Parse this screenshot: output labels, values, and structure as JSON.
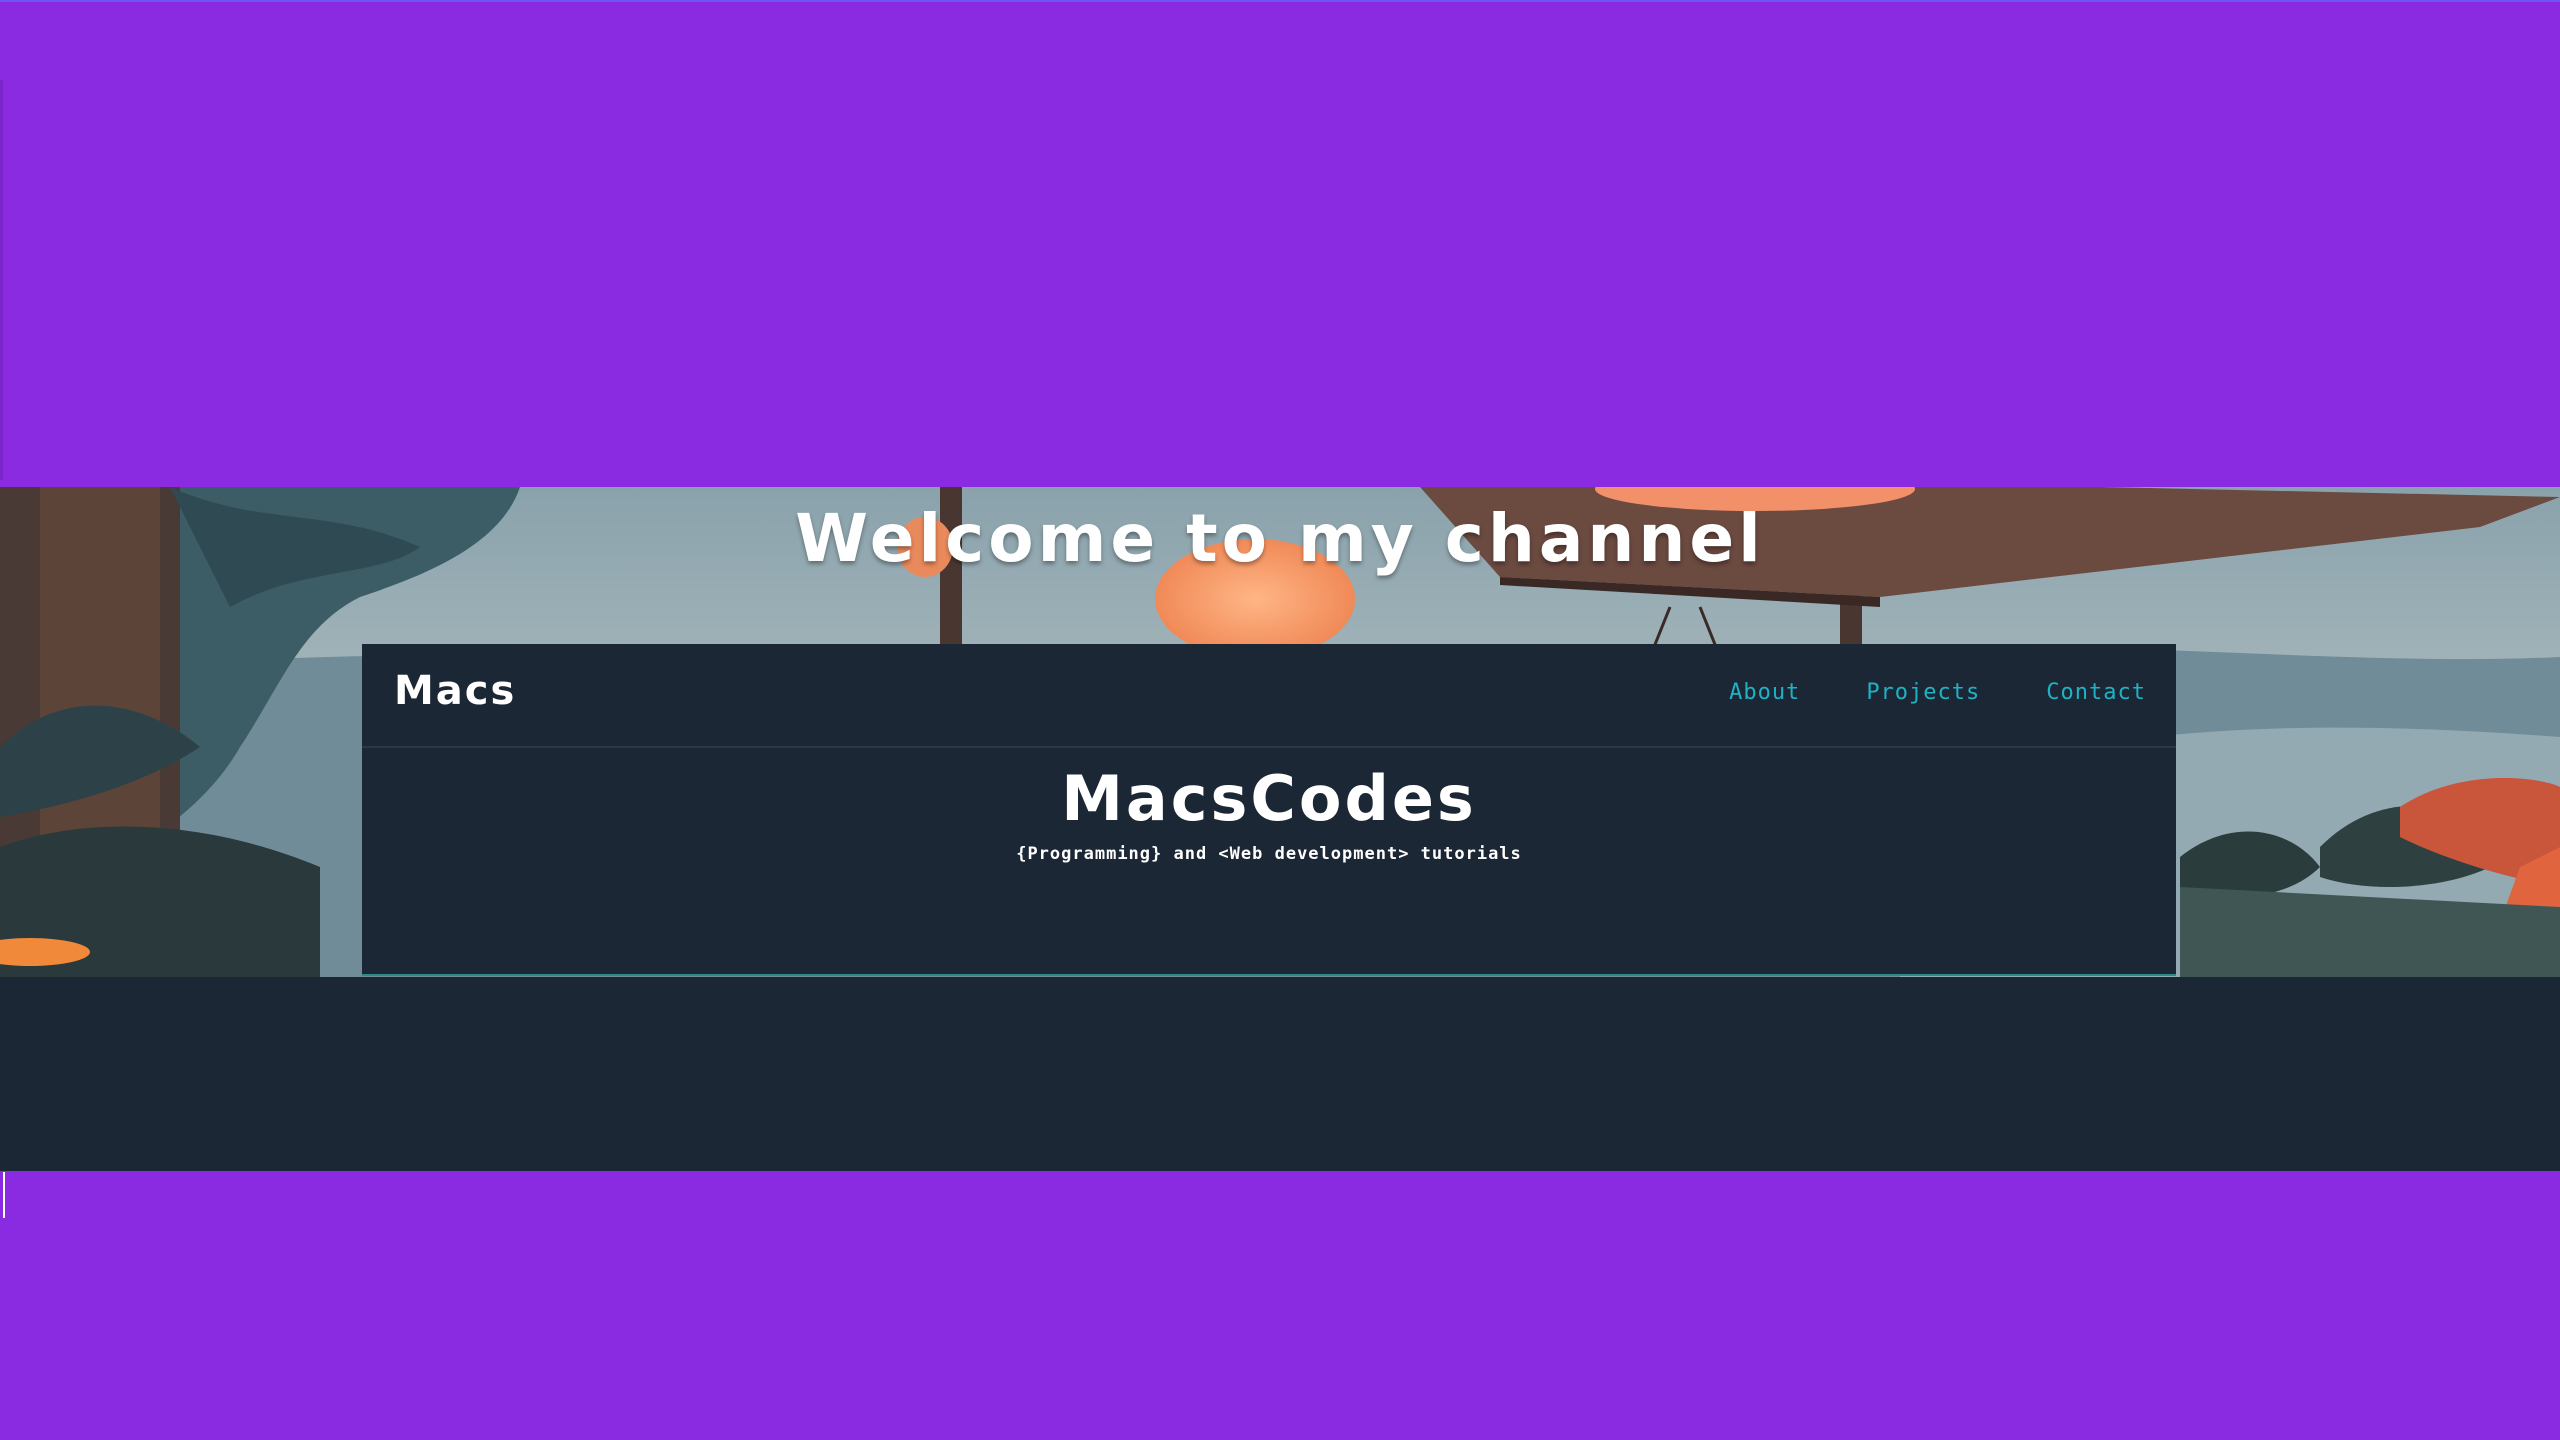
{
  "banner": {
    "welcome_text": "Welcome to my channel"
  },
  "site": {
    "brand": "Macs",
    "nav": [
      {
        "label": "About"
      },
      {
        "label": "Projects"
      },
      {
        "label": "Contact"
      }
    ],
    "hero_title": "MacsCodes",
    "hero_subtitle": "{Programming} and <Web development> tutorials"
  },
  "colors": {
    "purple_band": "#8a2be2",
    "card_bg": "#1b2734",
    "nav_link": "#20b2c4",
    "text_white": "#ffffff",
    "dark_band": "#1b2734"
  }
}
